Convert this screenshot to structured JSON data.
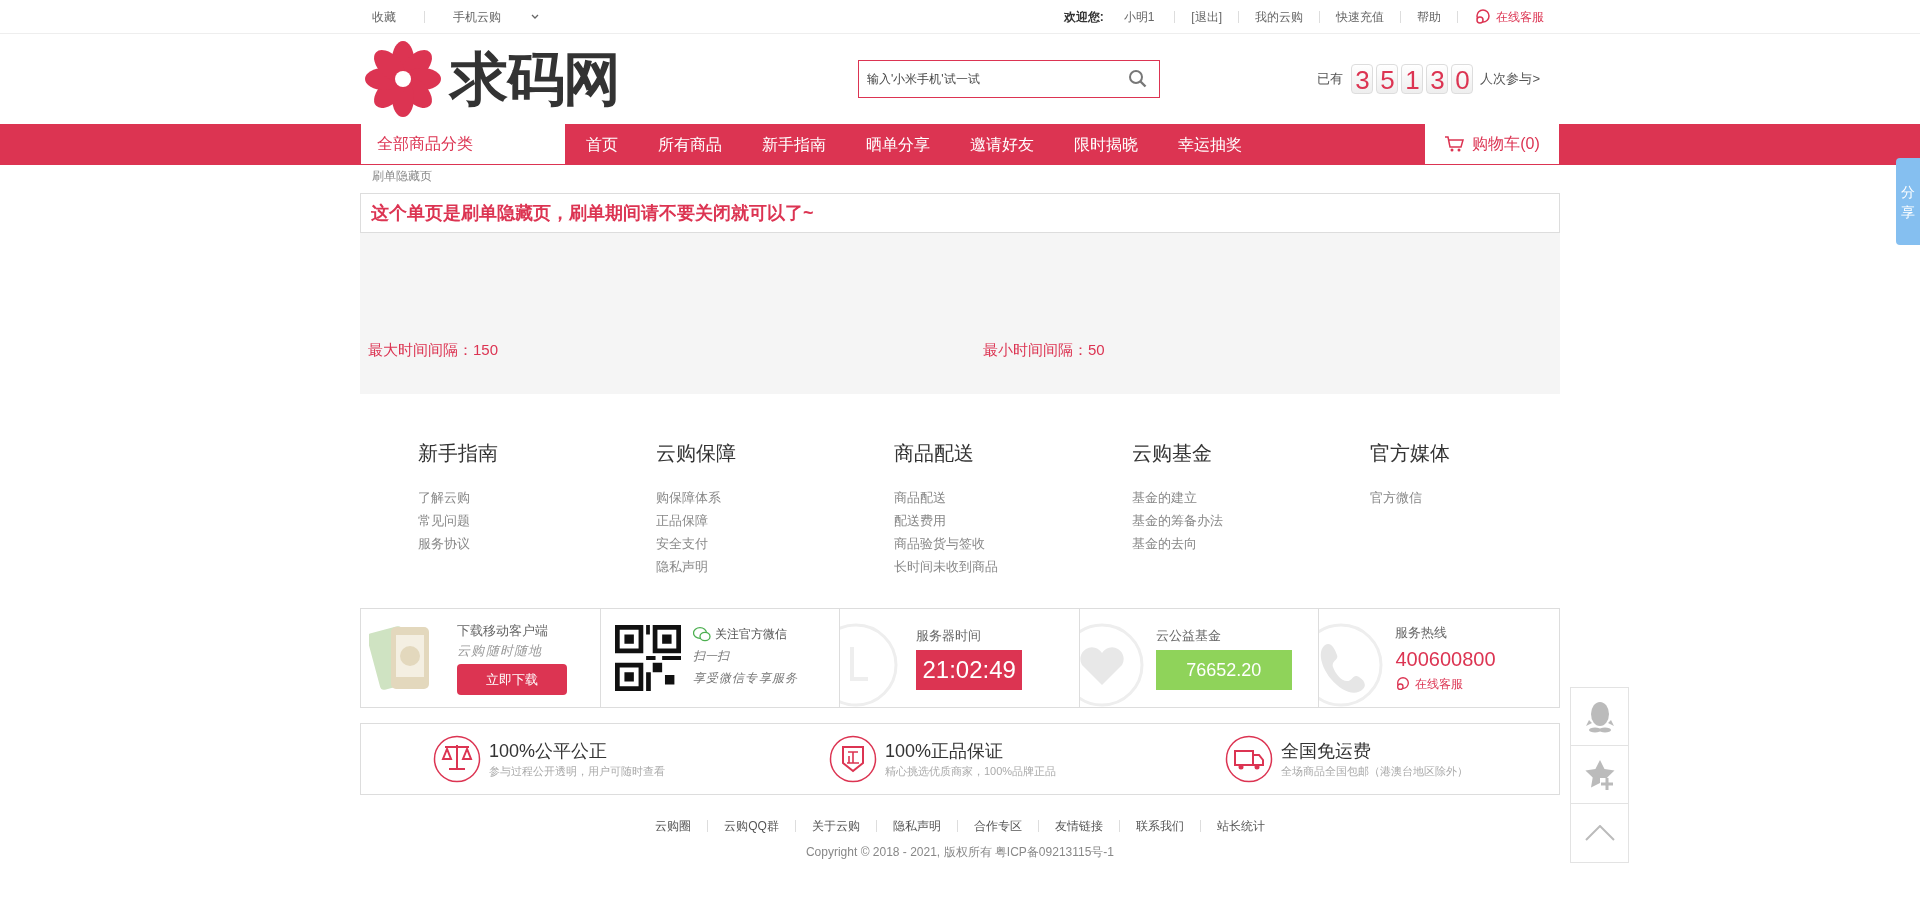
{
  "top_bar": {
    "left": [
      {
        "label": "收藏"
      },
      {
        "label": "手机云购",
        "dropdown": true
      }
    ],
    "greeting": "欢迎您:",
    "user": "小明1",
    "right": [
      "[退出]",
      "我的云购",
      "快速充值",
      "帮助"
    ],
    "service": "在线客服"
  },
  "header": {
    "logo": "求码网",
    "search": {
      "placeholder": "输入'小米手机'试一试"
    },
    "counter": {
      "prefix": "已有",
      "digits": [
        "3",
        "5",
        "1",
        "3",
        "0"
      ],
      "suffix": "人次参与>"
    }
  },
  "nav": {
    "category": "全部商品分类",
    "items": [
      "首页",
      "所有商品",
      "新手指南",
      "晒单分享",
      "邀请好友",
      "限时揭晓",
      "幸运抽奖"
    ],
    "cart": "购物车(0)"
  },
  "breadcrumb": "刷单隐藏页",
  "notice": "这个单页是刷单隐藏页，刷单期间请不要关闭就可以了~",
  "intervals": [
    {
      "label": "最大时间间隔：150"
    },
    {
      "label": "最小时间间隔：50"
    }
  ],
  "footer_columns": [
    {
      "title": "新手指南",
      "links": [
        "了解云购",
        "常见问题",
        "服务协议"
      ]
    },
    {
      "title": "云购保障",
      "links": [
        "购保障体系",
        "正品保障",
        "安全支付",
        "隐私声明"
      ]
    },
    {
      "title": "商品配送",
      "links": [
        "商品配送",
        "配送费用",
        "商品验货与签收",
        "长时间未收到商品"
      ]
    },
    {
      "title": "云购基金",
      "links": [
        "基金的建立",
        "基金的筹备办法",
        "基金的去向"
      ]
    },
    {
      "title": "官方媒体",
      "links": [
        "官方微信"
      ]
    }
  ],
  "info_band": [
    {
      "kind": "app",
      "title": "下载移动客户端",
      "subtitle": "云购随时随地",
      "button": "立即下载"
    },
    {
      "kind": "wechat",
      "title": "关注官方微信",
      "line1": "扫一扫",
      "line2": "享受微信专享服务"
    },
    {
      "kind": "time",
      "title": "服务器时间",
      "value": "21:02:49"
    },
    {
      "kind": "fund",
      "title": "云公益基金",
      "value": "76652.20"
    },
    {
      "kind": "hotline",
      "title": "服务热线",
      "value": "400600800",
      "link": "在线客服"
    }
  ],
  "guarantees": [
    {
      "kind": "scale",
      "title": "100%公平公正",
      "text": "参与过程公开透明，用户可随时查看"
    },
    {
      "kind": "genuine",
      "title": "100%正品保证",
      "text": "精心挑选优质商家，100%品牌正品"
    },
    {
      "kind": "truck",
      "title": "全国免运费",
      "text": "全场商品全国包邮（港澳台地区除外）"
    }
  ],
  "bottom_links": [
    "云购圈",
    "云购QQ群",
    "关于云购",
    "隐私声明",
    "合作专区",
    "友情链接",
    "联系我们",
    "站长统计"
  ],
  "copyright": "Copyright © 2018 - 2021, 版权所有 粤ICP备09213115号-1",
  "share_tab": "分享"
}
